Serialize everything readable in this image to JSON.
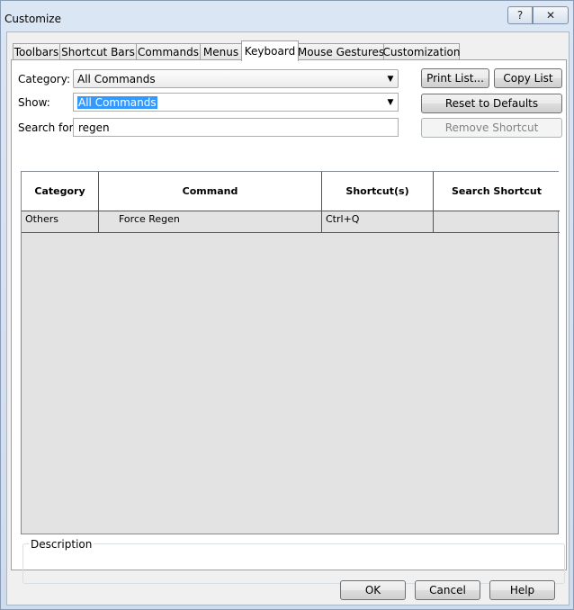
{
  "window": {
    "title": "Customize",
    "help_glyph": "?",
    "close_glyph": "✕"
  },
  "tabs": [
    "Toolbars",
    "Shortcut Bars",
    "Commands",
    "Menus",
    "Keyboard",
    "Mouse Gestures",
    "Customization"
  ],
  "active_tab": "Keyboard",
  "form": {
    "category_label": "Category:",
    "category_value": "All Commands",
    "show_label": "Show:",
    "show_value": "All Commands",
    "search_label": "Search for:",
    "search_value": "regen"
  },
  "buttons": {
    "print_list": "Print List...",
    "copy_list": "Copy List",
    "reset_defaults": "Reset to Defaults",
    "remove_shortcut": "Remove Shortcut",
    "ok": "OK",
    "cancel": "Cancel",
    "help": "Help"
  },
  "table": {
    "headers": [
      "Category",
      "Command",
      "Shortcut(s)",
      "Search Shortcut"
    ],
    "rows": [
      [
        "Others",
        "Force Regen",
        "Ctrl+Q",
        ""
      ]
    ]
  },
  "description": {
    "label": "Description",
    "text": ""
  }
}
